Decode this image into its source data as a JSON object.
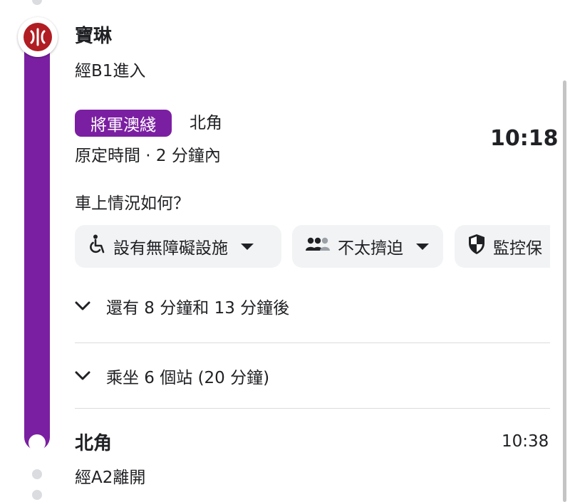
{
  "origin": {
    "station_name": "寶琳",
    "entrance": "經B1進入"
  },
  "line": {
    "name": "將軍澳綫",
    "color": "#7b1fa2",
    "direction": "北角",
    "schedule_status": "原定時間 · 2 分鐘內",
    "departure_time": "10:18"
  },
  "crowd_question": "車上情況如何？",
  "chips": [
    {
      "icon": "wheelchair-icon",
      "label": "設有無障礙設施"
    },
    {
      "icon": "people-icon",
      "label": "不太擠迫"
    },
    {
      "icon": "shield-icon",
      "label": "監控保"
    }
  ],
  "later_departures": "還有 8 分鐘和 13 分鐘後",
  "ride_summary": "乘坐 6 個站 (20 分鐘)",
  "destination": {
    "station_name": "北角",
    "exit": "經A2離開",
    "arrival_time": "10:38"
  },
  "colors": {
    "mtr_red": "#b01d22",
    "line_purple": "#7b1fa2",
    "chip_bg": "#f1f3f4"
  }
}
